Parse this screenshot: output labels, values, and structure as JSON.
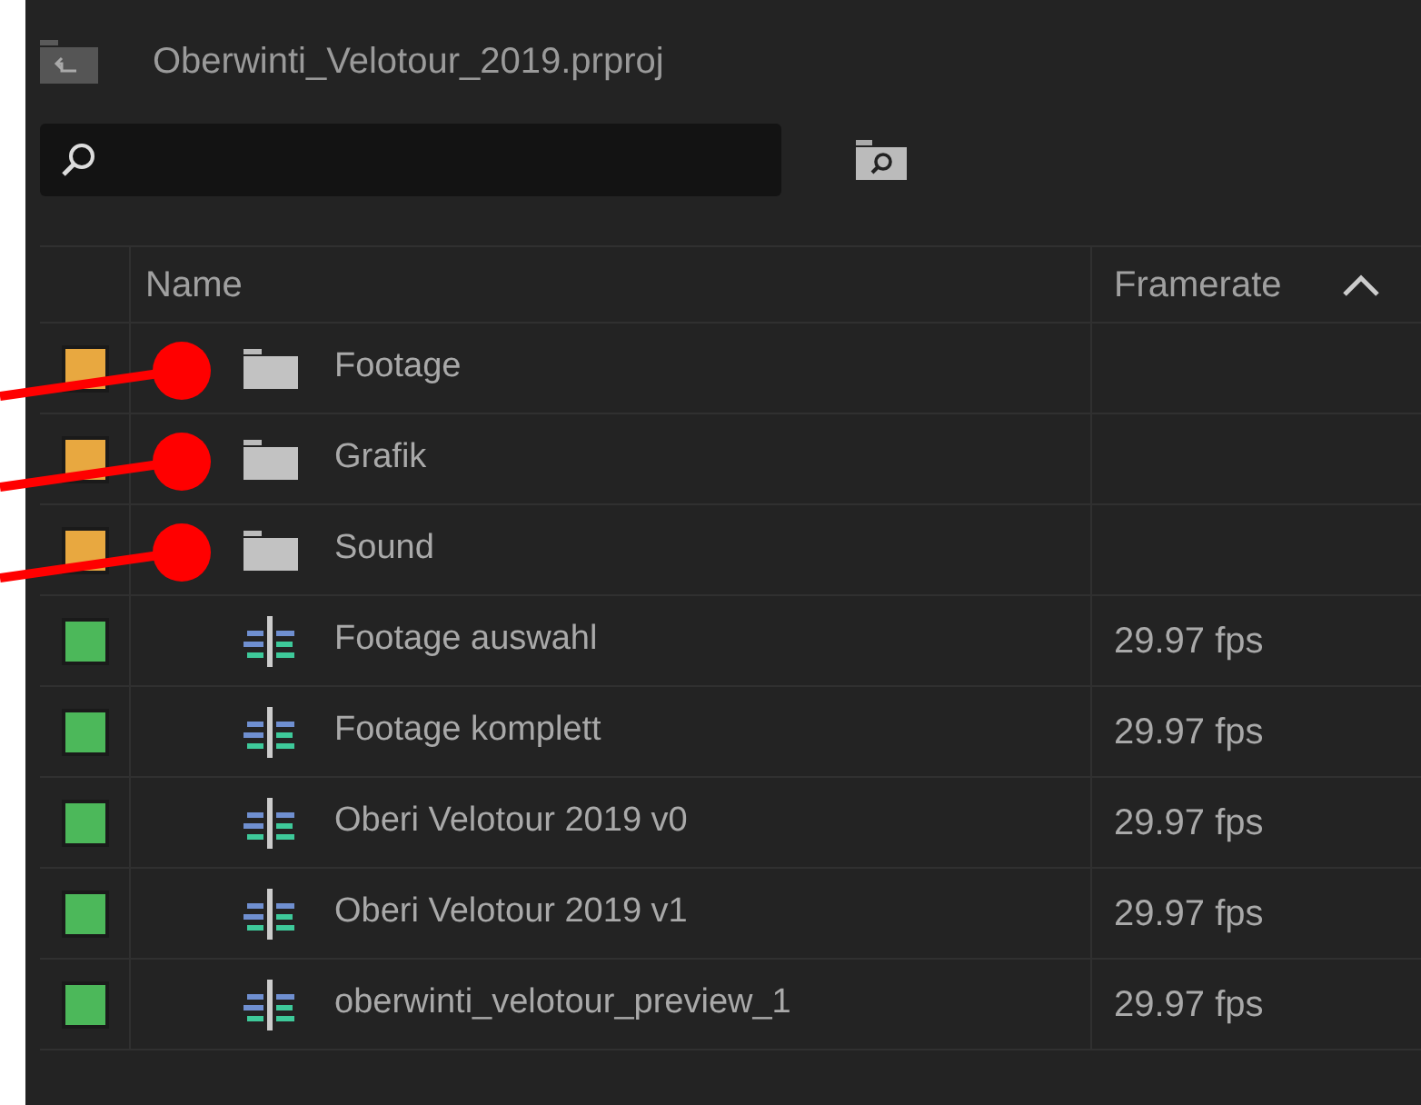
{
  "project": {
    "title": "Oberwinti_Velotour_2019.prproj"
  },
  "table": {
    "columns": [
      {
        "label": "Name"
      },
      {
        "label": "Framerate",
        "sorted": true
      }
    ],
    "rows": [
      {
        "kind": "folder",
        "name": "Footage",
        "color": "#e8a840",
        "marked": true
      },
      {
        "kind": "folder",
        "name": "Grafik",
        "color": "#e8a840",
        "marked": true
      },
      {
        "kind": "folder",
        "name": "Sound",
        "color": "#e8a840",
        "marked": true
      },
      {
        "kind": "sequence",
        "name": "Footage auswahl",
        "framerate": "29.97 fps",
        "color": "#4cb85a",
        "marked": false
      },
      {
        "kind": "sequence",
        "name": "Footage komplett",
        "framerate": "29.97 fps",
        "color": "#4cb85a",
        "marked": false
      },
      {
        "kind": "sequence",
        "name": "Oberi Velotour 2019 v0",
        "framerate": "29.97 fps",
        "color": "#4cb85a",
        "marked": false
      },
      {
        "kind": "sequence",
        "name": "Oberi Velotour 2019 v1",
        "framerate": "29.97 fps",
        "color": "#4cb85a",
        "marked": false
      },
      {
        "kind": "sequence",
        "name": "oberwinti_velotour_preview_1",
        "framerate": "29.97 fps",
        "color": "#4cb85a",
        "marked": false
      }
    ]
  }
}
